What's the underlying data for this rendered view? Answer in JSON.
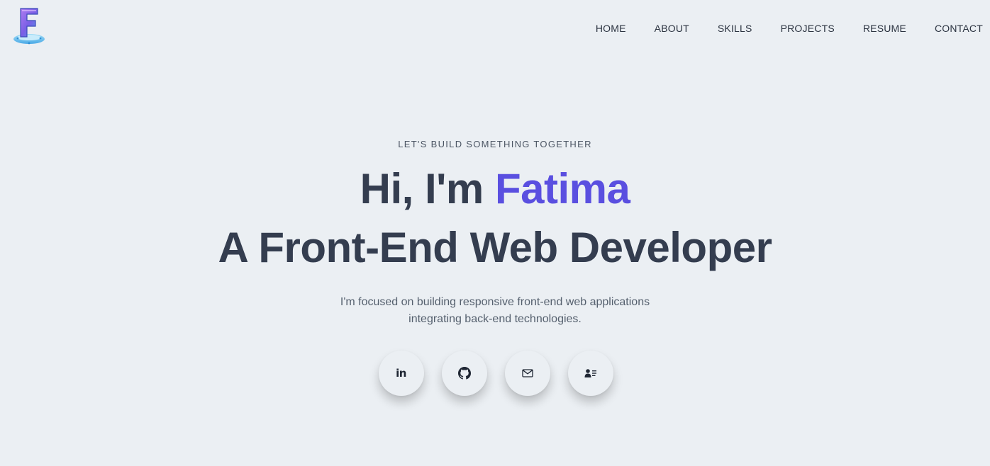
{
  "brand": {
    "logo_letter": "F",
    "logo_icon": "f-logo-icon"
  },
  "nav": {
    "items": [
      {
        "label": "HOME"
      },
      {
        "label": "ABOUT"
      },
      {
        "label": "SKILLS"
      },
      {
        "label": "PROJECTS"
      },
      {
        "label": "RESUME"
      },
      {
        "label": "CONTACT"
      }
    ]
  },
  "hero": {
    "eyebrow": "LET'S BUILD SOMETHING TOGETHER",
    "greeting": "Hi, I'm ",
    "name": "Fatima",
    "role": "A Front-End Web Developer",
    "description_line1": "I'm focused on building responsive front-end web applications",
    "description_line2": "integrating back-end technologies."
  },
  "socials": {
    "items": [
      {
        "icon": "linkedin-icon",
        "text": "in"
      },
      {
        "icon": "github-icon"
      },
      {
        "icon": "mail-icon"
      },
      {
        "icon": "contact-card-icon"
      }
    ]
  },
  "colors": {
    "background": "#ebeff3",
    "heading": "#343d4f",
    "accent": "#5a4fe0"
  }
}
